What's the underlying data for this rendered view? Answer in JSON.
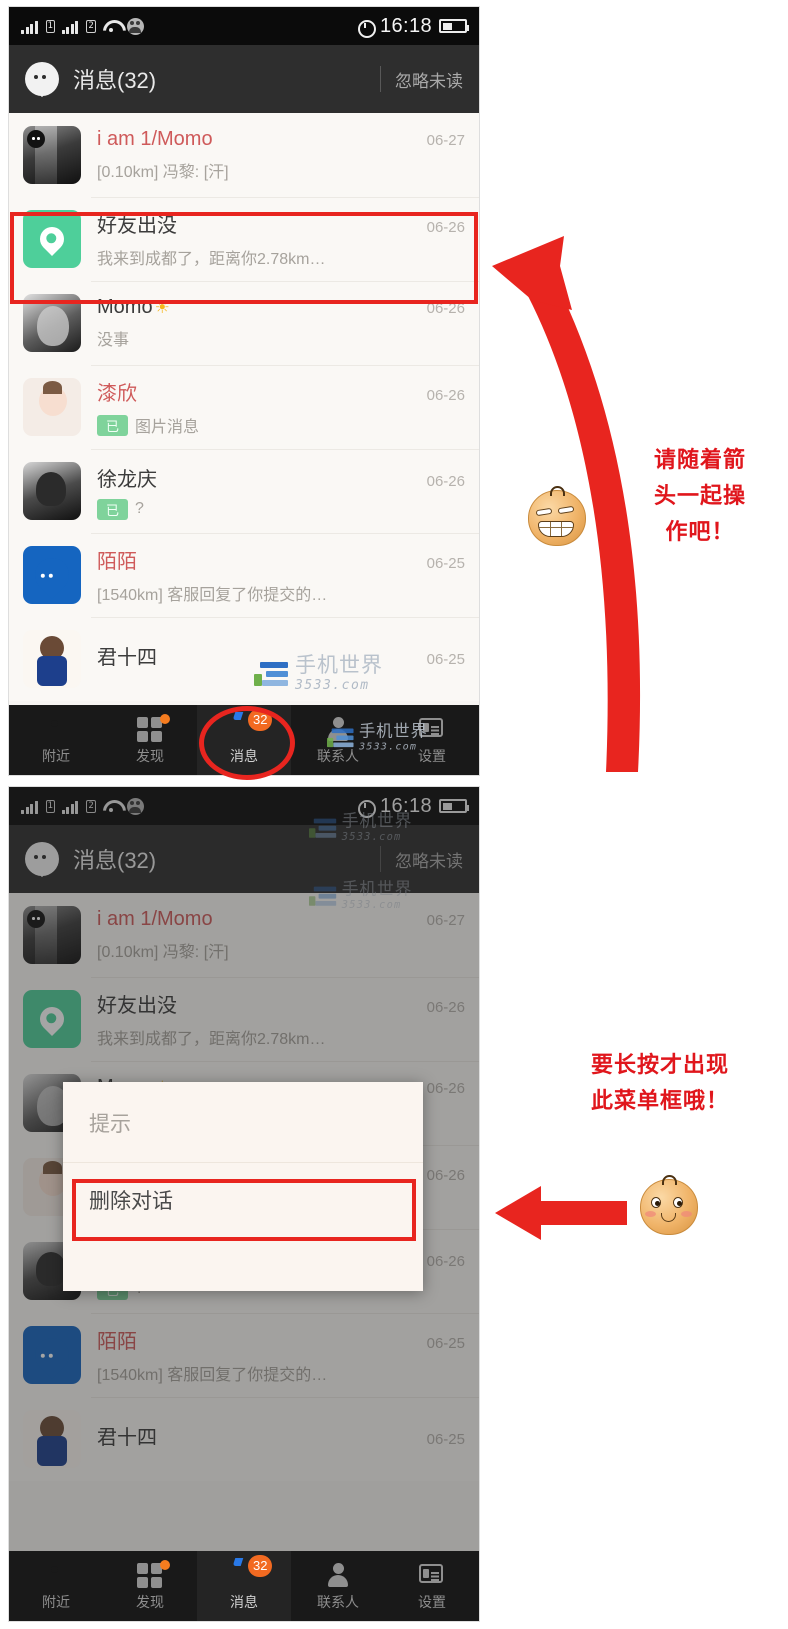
{
  "meta": {
    "app": "Momo",
    "watermark_cn": "手机世界",
    "watermark_en": "3533.com",
    "accent_red": "#e0161c",
    "badge_orange": "#f26a21",
    "green": "#4ecf9a"
  },
  "statusbar": {
    "time": "16:18",
    "sim1_label": "1",
    "sim2_label": "2",
    "icons": [
      "signal-sim1-icon",
      "signal-sim2-icon",
      "wifi-icon",
      "contacts-icon",
      "alarm-icon",
      "battery-icon"
    ]
  },
  "appbar": {
    "title": "消息(32)",
    "action": "忽略未读"
  },
  "conversations": [
    {
      "name": "i am 1/Momo",
      "name_accent": true,
      "date": "06-27",
      "preview": "[0.10km] 冯黎: [汗]",
      "badge": "",
      "avatar": "avatar-alley-photo",
      "suffix": ""
    },
    {
      "name": "好友出没",
      "name_accent": false,
      "date": "06-26",
      "preview": "我来到成都了，距离你2.78km…",
      "badge": "",
      "avatar": "avatar-nearby-pin",
      "suffix": ""
    },
    {
      "name": "Momo",
      "name_accent": false,
      "date": "06-26",
      "preview": "没事",
      "badge": "",
      "avatar": "avatar-girl-photo",
      "suffix": "☀"
    },
    {
      "name": "漆欣",
      "name_accent": true,
      "date": "06-26",
      "preview": "图片消息",
      "badge": "已",
      "avatar": "avatar-cartoon-girl",
      "suffix": ""
    },
    {
      "name": "徐龙庆",
      "name_accent": false,
      "date": "06-26",
      "preview": "?",
      "badge": "已",
      "avatar": "avatar-man-photo",
      "suffix": ""
    },
    {
      "name": "陌陌",
      "name_accent": true,
      "date": "06-25",
      "preview": "[1540km] 客服回复了你提交的…",
      "badge": "",
      "avatar": "avatar-momo-logo",
      "suffix": ""
    },
    {
      "name": "君十四",
      "name_accent": false,
      "date": "06-25",
      "preview": "",
      "badge": "",
      "avatar": "avatar-anime",
      "suffix": ""
    }
  ],
  "tabbar": {
    "items": [
      {
        "label": "附近",
        "icon": "location-pin-icon",
        "badge": "",
        "dot": false,
        "active": false
      },
      {
        "label": "发现",
        "icon": "grid-icon",
        "badge": "",
        "dot": true,
        "active": false
      },
      {
        "label": "消息",
        "icon": "chat-bubble-icon",
        "badge": "32",
        "dot": false,
        "active": true
      },
      {
        "label": "联系人",
        "icon": "person-icon",
        "badge": "",
        "dot": false,
        "active": false
      },
      {
        "label": "设置",
        "icon": "id-card-icon",
        "badge": "",
        "dot": false,
        "active": false
      }
    ]
  },
  "dialog": {
    "title": "提示",
    "items": [
      "删除对话"
    ]
  },
  "annotations": [
    {
      "id": "annotation-follow-arrow",
      "lines": [
        "请随着箭",
        "头一起操",
        "作吧！"
      ],
      "face": "grin-face-icon",
      "arrow": "curved-arrow-up-left"
    },
    {
      "id": "annotation-long-press",
      "lines": [
        "要长按才出现",
        "此菜单框哦！"
      ],
      "face": "shy-face-icon",
      "arrow": "straight-arrow-left"
    }
  ]
}
